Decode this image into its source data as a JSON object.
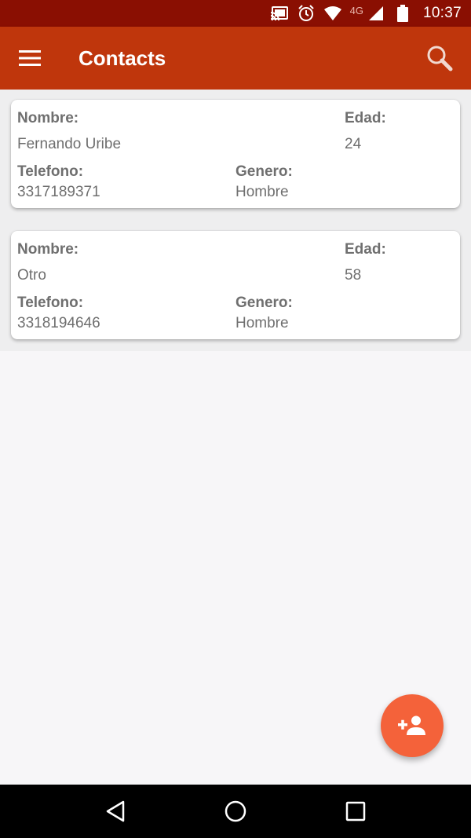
{
  "status_bar": {
    "network_type": "4G",
    "time": "10:37",
    "icons": [
      "cast-icon",
      "alarm-icon",
      "wifi-icon",
      "cell-signal-icon",
      "battery-icon"
    ]
  },
  "app_bar": {
    "title": "Contacts",
    "menu_icon": "hamburger-menu-icon",
    "search_icon": "search-icon",
    "color": "#bf360c"
  },
  "contacts": [
    {
      "nombre_label": "Nombre:",
      "nombre": "Fernando Uribe",
      "edad_label": "Edad:",
      "edad": "24",
      "telefono_label": "Telefono:",
      "telefono": "3317189371",
      "genero_label": "Genero:",
      "genero": "Hombre"
    },
    {
      "nombre_label": "Nombre:",
      "nombre": "Otro",
      "edad_label": "Edad:",
      "edad": "58",
      "telefono_label": "Telefono:",
      "telefono": "3318194646",
      "genero_label": "Genero:",
      "genero": "Hombre"
    }
  ],
  "fab": {
    "icon": "add-person-icon",
    "color": "#f4623a"
  },
  "nav_bar": {
    "icons": [
      "back-icon",
      "home-icon",
      "recents-icon"
    ]
  }
}
